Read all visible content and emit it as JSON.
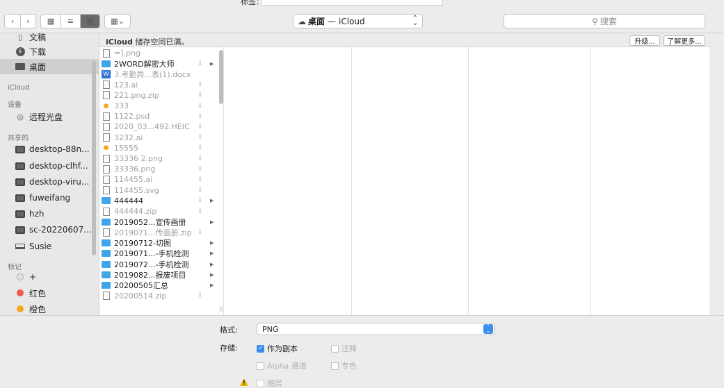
{
  "header": {
    "tags_label": "标签："
  },
  "toolbar": {
    "back_icon": "chevron-left",
    "forward_icon": "chevron-right",
    "location": {
      "cloud_icon": "cloud",
      "folder": "桌面",
      "sep": "—",
      "account": "iCloud"
    },
    "search": {
      "placeholder": "搜索",
      "icon": "magnifier"
    }
  },
  "sidebar": {
    "items_top": [
      {
        "label": "文稿",
        "icon": "document"
      },
      {
        "label": "下载",
        "icon": "download"
      },
      {
        "label": "桌面",
        "icon": "desktop",
        "selected": true
      }
    ],
    "icloud_heading": "iCloud",
    "devices_heading": "设备",
    "devices": [
      {
        "label": "远程光盘",
        "icon": "disc"
      }
    ],
    "shared_heading": "共享的",
    "shared": [
      {
        "label": "desktop-88n...",
        "icon": "monitor"
      },
      {
        "label": "desktop-clhf...",
        "icon": "monitor"
      },
      {
        "label": "desktop-viru...",
        "icon": "monitor"
      },
      {
        "label": "fuweifang",
        "icon": "monitor"
      },
      {
        "label": "hzh",
        "icon": "monitor"
      },
      {
        "label": "sc-20220607...",
        "icon": "monitor"
      },
      {
        "label": "Susie",
        "icon": "laptop"
      }
    ],
    "tags_heading": "标记",
    "tags": [
      {
        "label": "+",
        "color": "#c8c8c8"
      },
      {
        "label": "红色",
        "color": "#f05a4f"
      },
      {
        "label": "橙色",
        "color": "#f5a623"
      }
    ]
  },
  "banner": {
    "message_bold": "iCloud",
    "message_rest": " 储存空间已满。",
    "upgrade_label": "升级...",
    "learn_more_label": "了解更多..."
  },
  "files": [
    {
      "name": "=].png",
      "icon": "image",
      "dim": true,
      "cloud": false,
      "arrow": false
    },
    {
      "name": "2WORD解密大师",
      "icon": "folder",
      "dim": false,
      "cloud": true,
      "arrow": true
    },
    {
      "name": "3.考勤异...表(1).docx",
      "icon": "word",
      "dim": true,
      "cloud": false,
      "arrow": false
    },
    {
      "name": "123.ai",
      "icon": "ai",
      "dim": true,
      "cloud": true,
      "arrow": false
    },
    {
      "name": "221.png.zip",
      "icon": "zip",
      "dim": true,
      "cloud": true,
      "arrow": false
    },
    {
      "name": "333",
      "icon": "app",
      "dim": true,
      "cloud": true,
      "arrow": false
    },
    {
      "name": "1122.psd",
      "icon": "psd",
      "dim": true,
      "cloud": true,
      "arrow": false
    },
    {
      "name": "2020_03...492.HEIC",
      "icon": "image",
      "dim": true,
      "cloud": true,
      "arrow": false
    },
    {
      "name": "3232.ai",
      "icon": "ai",
      "dim": true,
      "cloud": true,
      "arrow": false
    },
    {
      "name": "15555",
      "icon": "app",
      "dim": true,
      "cloud": true,
      "arrow": false
    },
    {
      "name": "33336 2.png",
      "icon": "image",
      "dim": true,
      "cloud": true,
      "arrow": false
    },
    {
      "name": "33336.png",
      "icon": "image",
      "dim": true,
      "cloud": true,
      "arrow": false
    },
    {
      "name": "114455.ai",
      "icon": "ai",
      "dim": true,
      "cloud": true,
      "arrow": false
    },
    {
      "name": "114455.svg",
      "icon": "svg",
      "dim": true,
      "cloud": true,
      "arrow": false
    },
    {
      "name": "444444",
      "icon": "folder",
      "dim": false,
      "cloud": true,
      "arrow": true
    },
    {
      "name": "444444.zip",
      "icon": "zip",
      "dim": true,
      "cloud": true,
      "arrow": false
    },
    {
      "name": "2019052...宣传画册",
      "icon": "folder",
      "dim": false,
      "cloud": false,
      "arrow": true
    },
    {
      "name": "2019071...传画册.zip",
      "icon": "zip",
      "dim": true,
      "cloud": true,
      "arrow": false
    },
    {
      "name": "20190712-切图",
      "icon": "folder",
      "dim": false,
      "cloud": false,
      "arrow": true
    },
    {
      "name": "2019071...-手机检测",
      "icon": "folder",
      "dim": false,
      "cloud": false,
      "arrow": true
    },
    {
      "name": "2019072...-手机检测",
      "icon": "folder",
      "dim": false,
      "cloud": false,
      "arrow": true
    },
    {
      "name": "2019082...报废项目",
      "icon": "folder",
      "dim": false,
      "cloud": false,
      "arrow": true
    },
    {
      "name": "20200505汇总",
      "icon": "folder",
      "dim": false,
      "cloud": false,
      "arrow": true
    },
    {
      "name": "20200514.zip",
      "icon": "zip",
      "dim": true,
      "cloud": true,
      "arrow": false
    }
  ],
  "save": {
    "format_label": "格式:",
    "format_value": "PNG",
    "save_label": "存储:",
    "as_copy": "作为副本",
    "annotations": "注释",
    "alpha": "Alpha 通道",
    "spot": "专色",
    "layers": "图层"
  }
}
